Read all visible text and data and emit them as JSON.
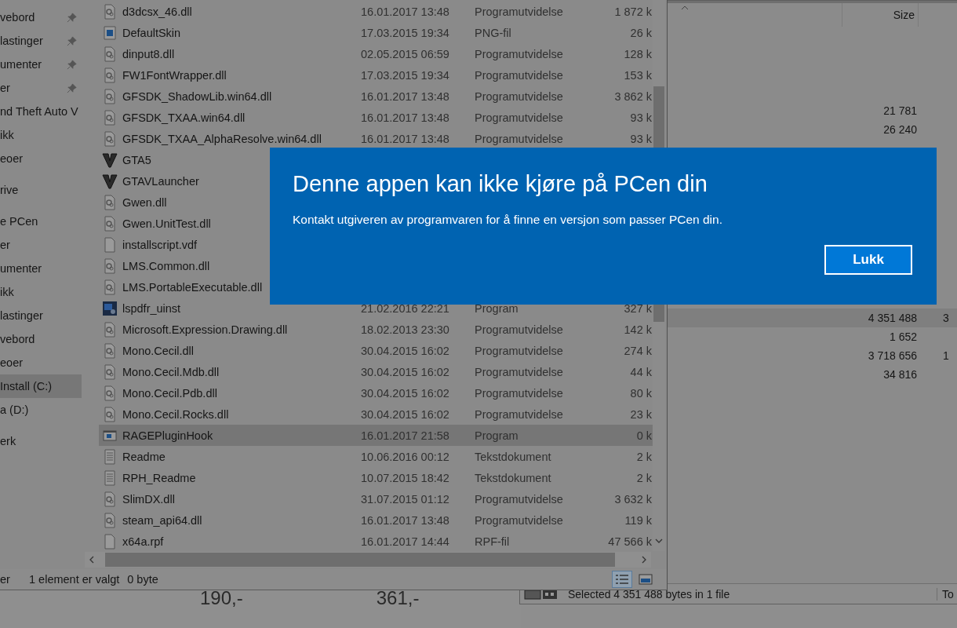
{
  "background_window": {
    "values": [
      "190,-",
      "361,-"
    ]
  },
  "right_window": {
    "header": {
      "size_label": "Size"
    },
    "rows_top": [
      {
        "size": "21 781",
        "selected": false
      },
      {
        "size": "26 240",
        "selected": false
      }
    ],
    "rows_bottom": [
      {
        "size": "4 351 488",
        "column_2": "3",
        "selected": true
      },
      {
        "size": "1 652",
        "selected": false
      },
      {
        "size": "3 718 656",
        "column_2": "1",
        "selected": false
      },
      {
        "size": "34 816",
        "selected": false
      }
    ],
    "status": "Selected 4 351 488 bytes in 1 file",
    "status_2": "To"
  },
  "explorer": {
    "sidebar": {
      "sections": [
        {
          "items": [
            {
              "label": "vebord",
              "pinned": true,
              "selected": false
            },
            {
              "label": "lastinger",
              "pinned": true,
              "selected": false
            },
            {
              "label": "umenter",
              "pinned": true,
              "selected": false
            },
            {
              "label": "er",
              "pinned": true,
              "selected": false
            },
            {
              "label": "nd Theft Auto V",
              "pinned": false,
              "selected": false
            },
            {
              "label": "ikk",
              "pinned": false,
              "selected": false
            },
            {
              "label": "eoer",
              "pinned": false,
              "selected": false
            }
          ]
        },
        {
          "items": [
            {
              "label": "rive",
              "pinned": false,
              "selected": false
            }
          ]
        },
        {
          "items": [
            {
              "label": "e PCen",
              "pinned": false,
              "selected": false
            },
            {
              "label": "er",
              "pinned": false,
              "selected": false
            },
            {
              "label": "umenter",
              "pinned": false,
              "selected": false
            },
            {
              "label": "ikk",
              "pinned": false,
              "selected": false
            },
            {
              "label": "lastinger",
              "pinned": false,
              "selected": false
            },
            {
              "label": "vebord",
              "pinned": false,
              "selected": false
            },
            {
              "label": "eoer",
              "pinned": false,
              "selected": false
            },
            {
              "label": "Install (C:)",
              "pinned": false,
              "selected": true
            },
            {
              "label": "a (D:)",
              "pinned": false,
              "selected": false
            }
          ]
        },
        {
          "items": [
            {
              "label": "erk",
              "pinned": false,
              "selected": false
            }
          ]
        }
      ]
    },
    "files": {
      "rows": [
        {
          "kind": "dll",
          "name": "d3dcsx_46.dll",
          "date": "16.01.2017 13:48",
          "type": "Programutvidelse",
          "size": "1 872 k",
          "selected": false
        },
        {
          "kind": "image",
          "name": "DefaultSkin",
          "date": "17.03.2015 19:34",
          "type": "PNG-fil",
          "size": "26 k",
          "selected": false
        },
        {
          "kind": "dll",
          "name": "dinput8.dll",
          "date": "02.05.2015 06:59",
          "type": "Programutvidelse",
          "size": "128 k",
          "selected": false
        },
        {
          "kind": "dll",
          "name": "FW1FontWrapper.dll",
          "date": "17.03.2015 19:34",
          "type": "Programutvidelse",
          "size": "153 k",
          "selected": false
        },
        {
          "kind": "dll",
          "name": "GFSDK_ShadowLib.win64.dll",
          "date": "16.01.2017 13:48",
          "type": "Programutvidelse",
          "size": "3 862 k",
          "selected": false
        },
        {
          "kind": "dll",
          "name": "GFSDK_TXAA.win64.dll",
          "date": "16.01.2017 13:48",
          "type": "Programutvidelse",
          "size": "93 k",
          "selected": false
        },
        {
          "kind": "dll",
          "name": "GFSDK_TXAA_AlphaResolve.win64.dll",
          "date": "16.01.2017 13:48",
          "type": "Programutvidelse",
          "size": "93 k",
          "selected": false
        },
        {
          "kind": "game",
          "name": "GTA5",
          "selected": false
        },
        {
          "kind": "game",
          "name": "GTAVLauncher",
          "selected": false
        },
        {
          "kind": "dll",
          "name": "Gwen.dll",
          "selected": false
        },
        {
          "kind": "dll",
          "name": "Gwen.UnitTest.dll",
          "selected": false
        },
        {
          "kind": "blank",
          "name": "installscript.vdf",
          "selected": false
        },
        {
          "kind": "dll",
          "name": "LMS.Common.dll",
          "selected": false
        },
        {
          "kind": "dll",
          "name": "LMS.PortableExecutable.dll",
          "selected": false
        },
        {
          "kind": "app",
          "name": "lspdfr_uinst",
          "date": "21.02.2016 22:21",
          "type": "Program",
          "size": "327 k",
          "selected": false
        },
        {
          "kind": "dll",
          "name": "Microsoft.Expression.Drawing.dll",
          "date": "18.02.2013 23:30",
          "type": "Programutvidelse",
          "size": "142 k",
          "selected": false
        },
        {
          "kind": "dll",
          "name": "Mono.Cecil.dll",
          "date": "30.04.2015 16:02",
          "type": "Programutvidelse",
          "size": "274 k",
          "selected": false
        },
        {
          "kind": "dll",
          "name": "Mono.Cecil.Mdb.dll",
          "date": "30.04.2015 16:02",
          "type": "Programutvidelse",
          "size": "44 k",
          "selected": false
        },
        {
          "kind": "dll",
          "name": "Mono.Cecil.Pdb.dll",
          "date": "30.04.2015 16:02",
          "type": "Programutvidelse",
          "size": "80 k",
          "selected": false
        },
        {
          "kind": "dll",
          "name": "Mono.Cecil.Rocks.dll",
          "date": "30.04.2015 16:02",
          "type": "Programutvidelse",
          "size": "23 k",
          "selected": false
        },
        {
          "kind": "window",
          "name": "RAGEPluginHook",
          "date": "16.01.2017 21:58",
          "type": "Program",
          "size": "0 k",
          "selected": true
        },
        {
          "kind": "text",
          "name": "Readme",
          "date": "10.06.2016 00:12",
          "type": "Tekstdokument",
          "size": "2 k",
          "selected": false
        },
        {
          "kind": "text",
          "name": "RPH_Readme",
          "date": "10.07.2015 18:42",
          "type": "Tekstdokument",
          "size": "2 k",
          "selected": false
        },
        {
          "kind": "dll",
          "name": "SlimDX.dll",
          "date": "31.07.2015 01:12",
          "type": "Programutvidelse",
          "size": "3 632 k",
          "selected": false
        },
        {
          "kind": "dll",
          "name": "steam_api64.dll",
          "date": "16.01.2017 13:48",
          "type": "Programutvidelse",
          "size": "119 k",
          "selected": false
        },
        {
          "kind": "blank",
          "name": "x64a.rpf",
          "date": "16.01.2017 14:44",
          "type": "RPF-fil",
          "size": "47 566 k",
          "selected": false
        }
      ]
    },
    "status_bar": {
      "location": "er",
      "selection": "1 element er valgt",
      "size": "0 byte"
    },
    "view_buttons": [
      {
        "kind": "details",
        "selected": true
      },
      {
        "kind": "thumbnails",
        "selected": false
      }
    ]
  },
  "dialog": {
    "title": "Denne appen kan ikke kjøre på PCen din",
    "message": "Kontakt utgiveren av programvaren for å finne en versjon som passer PCen din.",
    "button": "Lukk"
  }
}
